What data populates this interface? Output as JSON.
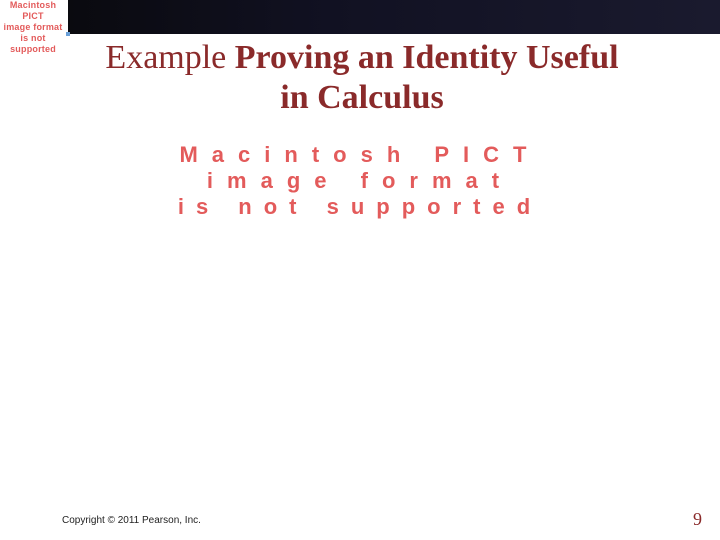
{
  "pict_small": {
    "line1": "Macintosh PICT",
    "line2": "image format",
    "line3": "is not supported"
  },
  "title": {
    "word1": "Example",
    "rest_line1": "Proving an Identity Useful",
    "line2": "in Calculus"
  },
  "pict_large": {
    "line1": "Macintosh PICT",
    "line2": "image format",
    "line3": "is not supported"
  },
  "footer": {
    "copyright": "Copyright © 2011 Pearson, Inc.",
    "slide_number": "9"
  }
}
